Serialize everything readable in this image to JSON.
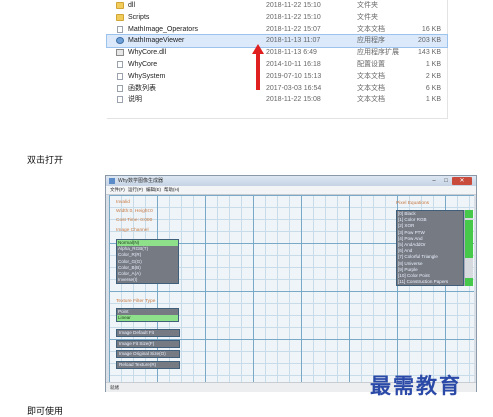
{
  "explorer": {
    "files": [
      {
        "name": "dll",
        "date": "2018-11-22 15:10",
        "type": "文件夹",
        "size": "",
        "icon": "folder-icon",
        "selected": false
      },
      {
        "name": "Scripts",
        "date": "2018-11-22 15:10",
        "type": "文件夹",
        "size": "",
        "icon": "folder-icon",
        "selected": false
      },
      {
        "name": "MathImage_Operators",
        "date": "2018-11-22 15:07",
        "type": "文本文档",
        "size": "16 KB",
        "icon": "text-file-icon",
        "selected": false
      },
      {
        "name": "MathImageViewer",
        "date": "2018-11-13 11:07",
        "type": "应用程序",
        "size": "203 KB",
        "icon": "application-icon",
        "selected": true
      },
      {
        "name": "WhyCore.dll",
        "date": "2018-11-13 6:49",
        "type": "应用程序扩展",
        "size": "143 KB",
        "icon": "dll-icon",
        "selected": false
      },
      {
        "name": "WhyCore",
        "date": "2014-10-11 16:18",
        "type": "配置设置",
        "size": "1 KB",
        "icon": "config-file-icon",
        "selected": false
      },
      {
        "name": "WhySystem",
        "date": "2019-07-10 15:13",
        "type": "文本文档",
        "size": "2 KB",
        "icon": "text-file-icon",
        "selected": false
      },
      {
        "name": "函数列表",
        "date": "2017-03-03 16:54",
        "type": "文本文档",
        "size": "6 KB",
        "icon": "text-file-icon",
        "selected": false
      },
      {
        "name": "说明",
        "date": "2018-11-22 15:08",
        "type": "文本文档",
        "size": "1 KB",
        "icon": "text-file-icon",
        "selected": false
      }
    ],
    "arrow_color": "#e02020"
  },
  "captions": {
    "double_click": "双击打开",
    "bottom": "即可使用"
  },
  "app": {
    "title": "Why数学图像生成器",
    "menu": [
      "文件(F)",
      "运行(P)",
      "编辑(E)",
      "帮助(H)"
    ],
    "info": {
      "label1": "Invalid",
      "label2": "Width:0, Height:0",
      "label3": "Cost Time: 0:000",
      "label4": "Image Channel"
    },
    "channels": [
      "Normal(N)",
      "Alpha_RGB(T)",
      "Color_R(R)",
      "Color_G(G)",
      "Color_B(B)",
      "Color_A(A)",
      "Inverse(I)"
    ],
    "channels_selected": 0,
    "filter_label": "Texture Filter Type",
    "filters": [
      "Point",
      "Linear"
    ],
    "filters_selected": 1,
    "buttons": [
      "Image Default Fit",
      "Image Fit Size(F)",
      "Image Original Size(O)",
      "Reload Texture(R)"
    ],
    "pixel_label": "Pixel Equations",
    "equations": [
      "[0] Black",
      "[1] Color RGB",
      "[2] XOR",
      "[3] Pow PTW",
      "[4] Pow And",
      "[5] AndAddOr",
      "[6] And",
      "[7] Colorful Triangle",
      "[8] Universe",
      "[9] Purple",
      "[10] Color Point",
      "[11] Construction Papers"
    ],
    "status": "就绪",
    "colors": {
      "selected": "#8fe08a",
      "list_bg": "#767b83",
      "grid": "#7aa9c7",
      "label": "#c87a45",
      "scroll": "#46c84a"
    }
  },
  "watermark": "最需教育"
}
